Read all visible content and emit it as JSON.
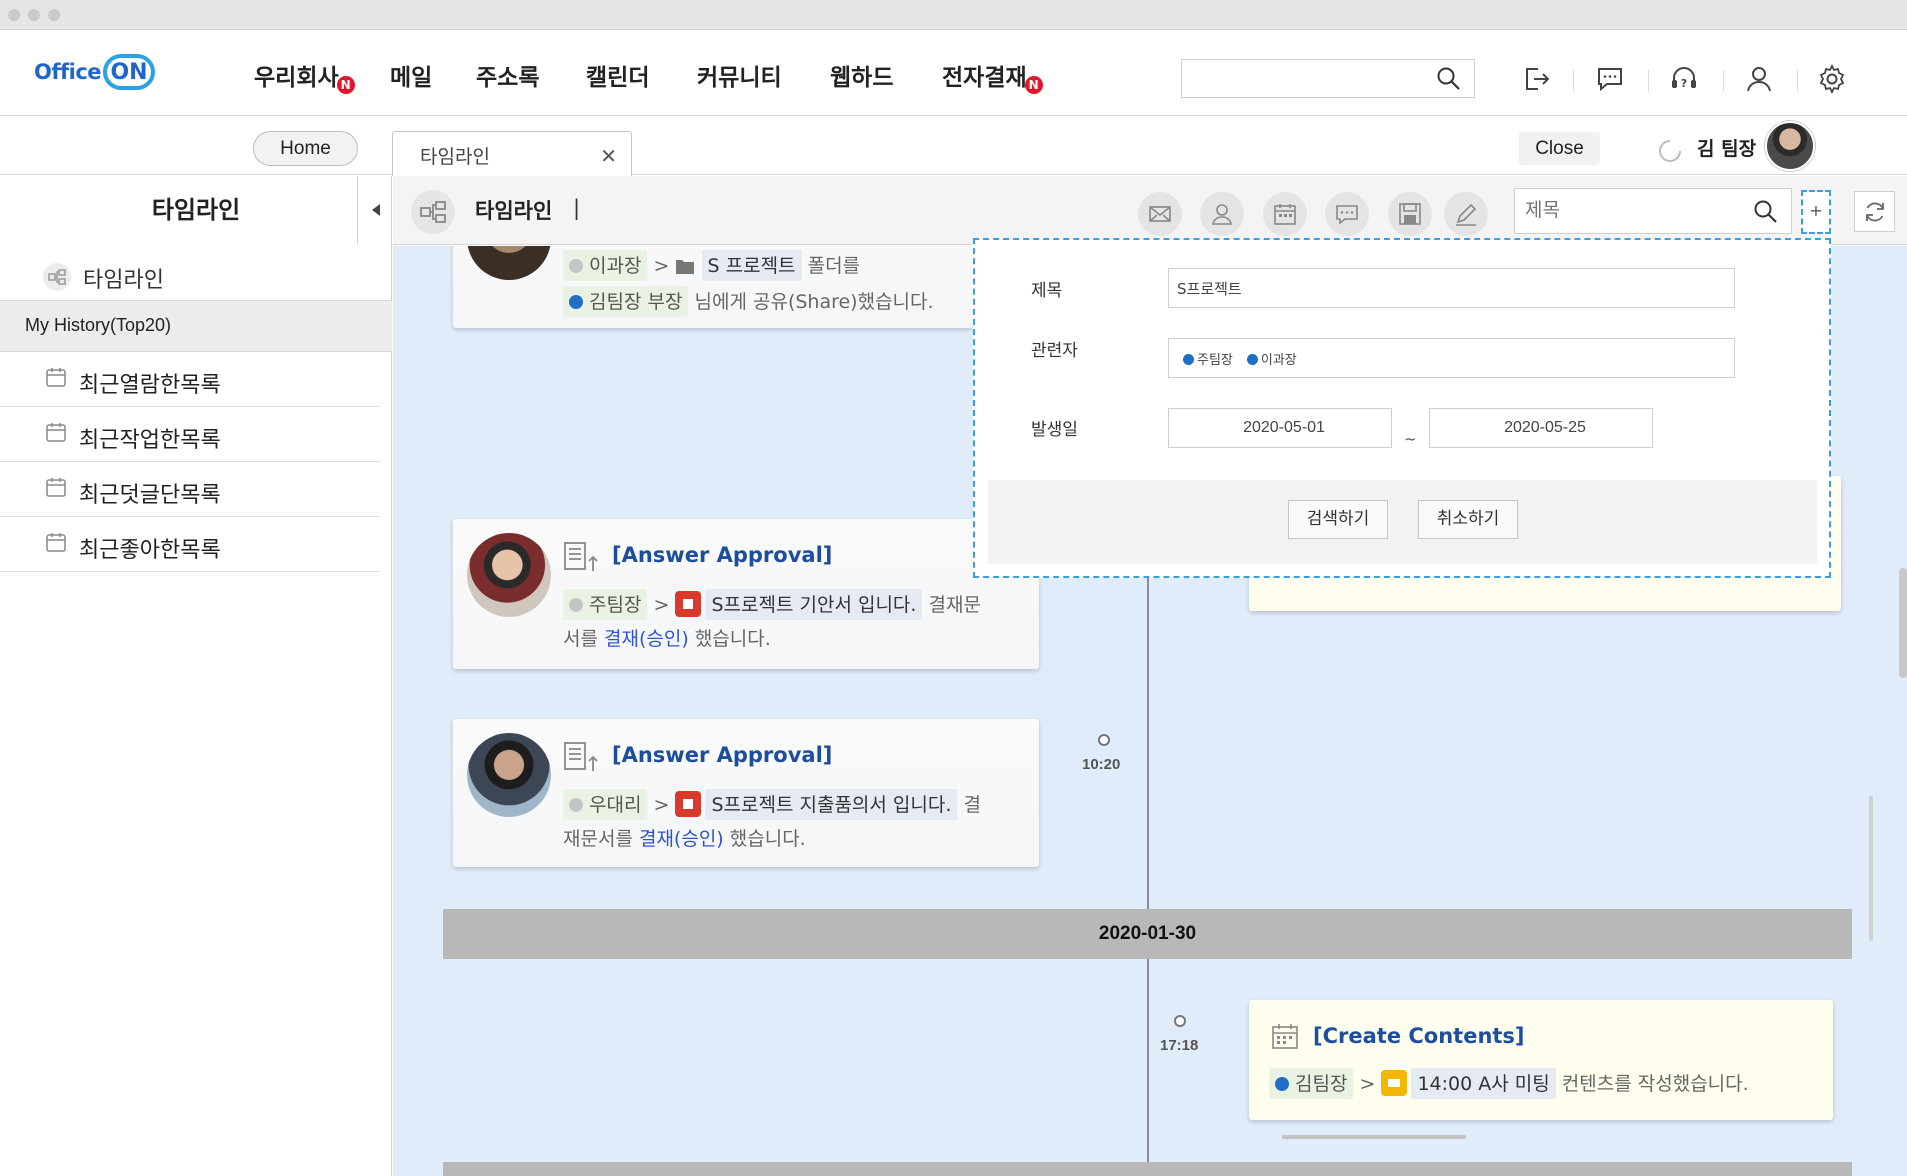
{
  "app": {
    "logo_text": "Office",
    "logo_on": "ON"
  },
  "menu": {
    "items": [
      {
        "label": "우리회사",
        "badge": "N"
      },
      {
        "label": "메일"
      },
      {
        "label": "주소록"
      },
      {
        "label": "캘린더"
      },
      {
        "label": "커뮤니티"
      },
      {
        "label": "웹하드"
      },
      {
        "label": "전자결재",
        "badge": "N"
      }
    ]
  },
  "top_search": {
    "value": ""
  },
  "tabs_row": {
    "home_label": "Home",
    "tab_label": "타임라인",
    "close_label": "Close",
    "user_name": "김 팀장"
  },
  "sidebar": {
    "title": "타임라인",
    "main_item": "타임라인",
    "history_header": "My History(Top20)",
    "items": [
      "최근열람한목록",
      "최근작업한목록",
      "최근덧글단목록",
      "최근좋아한목록"
    ]
  },
  "content_toolbar": {
    "title": "타임라인",
    "divider": "|",
    "search_placeholder": "제목",
    "plus": "+"
  },
  "timeline": {
    "card0": {
      "user": "이과장",
      "folder": "S 프로젝트",
      "after_folder": "폴더를",
      "target": "김팀장 부장",
      "action": "님에게 공유(Share)했습니다."
    },
    "card1": {
      "heading": "[Answer Approval]",
      "user": "주팀장",
      "doc": "S프로젝트 기안서 입니다.",
      "tail1": "결재문",
      "tail2_pre": "서를",
      "tail2_link": "결재(승인)",
      "tail2_post": "했습니다."
    },
    "card2": {
      "heading": "[Answer Approval]",
      "user": "우대리",
      "doc": "S프로젝트 지출품의서 입니다.",
      "tail1": "결",
      "tail2_pre": "재문서를",
      "tail2_link": "결재(승인)",
      "tail2_post": "했습니다.",
      "time": "10:20"
    },
    "date_band": "2020-01-30",
    "card3": {
      "heading": "[Create Contents]",
      "user": "김팀장",
      "doc": "14:00 A사 미팅",
      "action": "컨텐츠를 작성했습니다.",
      "time": "17:18"
    }
  },
  "search_popup": {
    "title_label": "제목",
    "title_value": "S프로젝트",
    "related_label": "관련자",
    "related": [
      "주팀장",
      "이과장"
    ],
    "date_label": "발생일",
    "date_from": "2020-05-01",
    "date_tilde": "~",
    "date_to": "2020-05-25",
    "search_button": "검색하기",
    "cancel_button": "취소하기"
  },
  "colors": {
    "brand": "#1e66c9",
    "timeline_bg": "#e0ecfa",
    "heading": "#1d4e9c",
    "link": "#2d55c8",
    "badge": "#e0182e",
    "popup_border": "#3ba0d9"
  }
}
